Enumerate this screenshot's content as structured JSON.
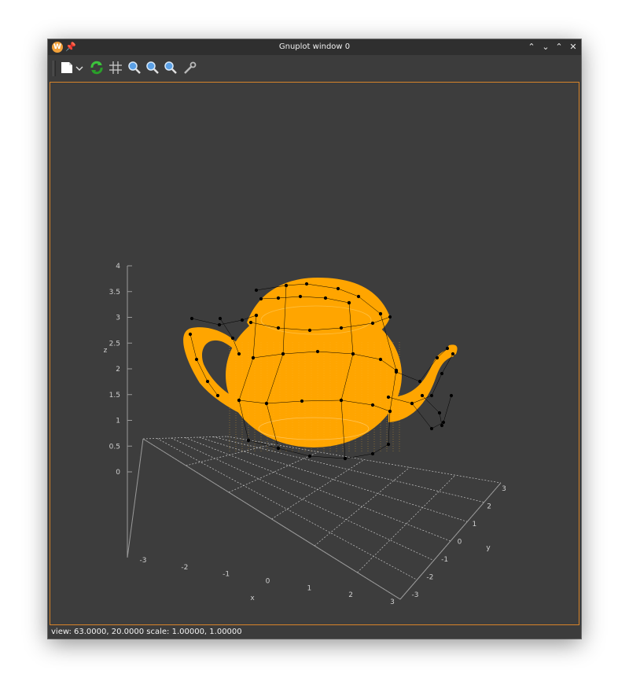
{
  "window": {
    "title": "Gnuplot window 0",
    "app_icon_letter": "W"
  },
  "toolbar": {
    "buttons": [
      "export-icon",
      "dropdown-chevron-icon",
      "replot-icon",
      "grid-icon",
      "zoom-in-icon",
      "zoom-out-icon",
      "zoom-fit-icon",
      "settings-icon"
    ]
  },
  "plot": {
    "surface_color": "#ffa500",
    "control_net_color": "#000000",
    "axis_color": "#9a9a9a",
    "grid_color": "#c8c8c8",
    "x_label": "x",
    "y_label": "y",
    "z_label": "z",
    "x_ticks": [
      "-3",
      "-2",
      "-1",
      "0",
      "1",
      "2",
      "3"
    ],
    "y_ticks": [
      "-3",
      "-2",
      "-1",
      "0",
      "1",
      "2",
      "3"
    ],
    "z_ticks": [
      "4",
      "3.5",
      "3",
      "2.5",
      "2",
      "1.5",
      "1",
      "0.5",
      "0"
    ]
  },
  "status": {
    "text": "view: 63.0000,  20.0000   scale: 1.00000,  1.00000"
  }
}
